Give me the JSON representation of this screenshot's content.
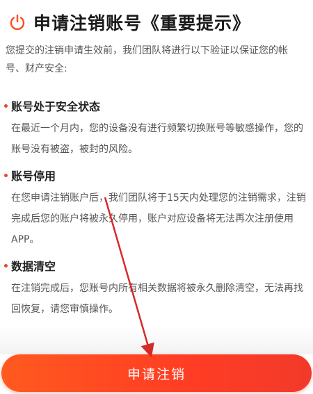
{
  "header": {
    "icon": "power-icon",
    "title": "申请注销账号《重要提示》"
  },
  "intro": "您提交的注销申请生效前，我们团队将进行以下验证以保证您的帐号、财产安全:",
  "sections": [
    {
      "heading": "账号处于安全状态",
      "text": "在最近一个月内，您的设备没有进行频繁切换账号等敏感操作，您的账号没有被盗，被封的风险。"
    },
    {
      "heading": "账号停用",
      "text": "在您申请注销账户后，我们团队将于15天内处理您的注销需求，注销完成后您的账户将被永久停用，账户对应设备将无法再次注册使用APP。"
    },
    {
      "heading": "数据清空",
      "text": "在注销完成后，您账号内所有相关数据将被永久删除清空，无法再找回恢复，请您审慎操作。"
    }
  ],
  "button": {
    "label": "申请注销"
  },
  "colors": {
    "accent": "#ff4a24",
    "bullet": "#e8472a",
    "annotation_arrow": "#d42a2a"
  }
}
